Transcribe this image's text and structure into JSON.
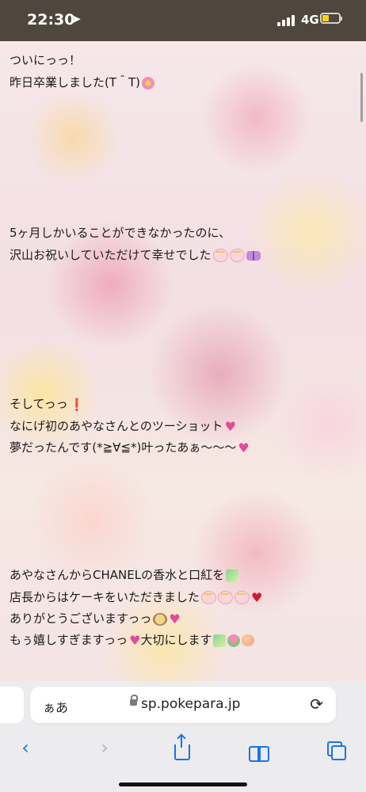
{
  "status_bar": {
    "time": "22:30",
    "network": "4G"
  },
  "post": {
    "paragraph1": [
      "ついにっっ！",
      "昨日卒業しました(T＾T)"
    ],
    "paragraph2": [
      "5ヶ月しかいることができなかったのに、",
      "沢山お祝いしていただけて幸せでした"
    ],
    "paragraph3": [
      "そしてっっ",
      "なにげ初のあやなさんとのツーショット",
      "夢だったんです(*≧∀≦*)叶ったあぁ〜〜〜"
    ],
    "paragraph4": [
      "あやなさんからCHANELの香水と口紅を",
      "店長からはケーキをいただきました",
      "ありがとうございますっっ",
      "もぅ嬉しすぎますっっ",
      "大切にします"
    ]
  },
  "address_bar": {
    "aa": "ぁあ",
    "url": "sp.pokepara.jp",
    "reload_icon": "reload-icon"
  },
  "toolbar": {
    "back": "‹",
    "forward": "›"
  },
  "colors": {
    "status_bar_bg": "#4f463d",
    "link_blue": "#1a73e8",
    "battery": "#f7d31c"
  }
}
